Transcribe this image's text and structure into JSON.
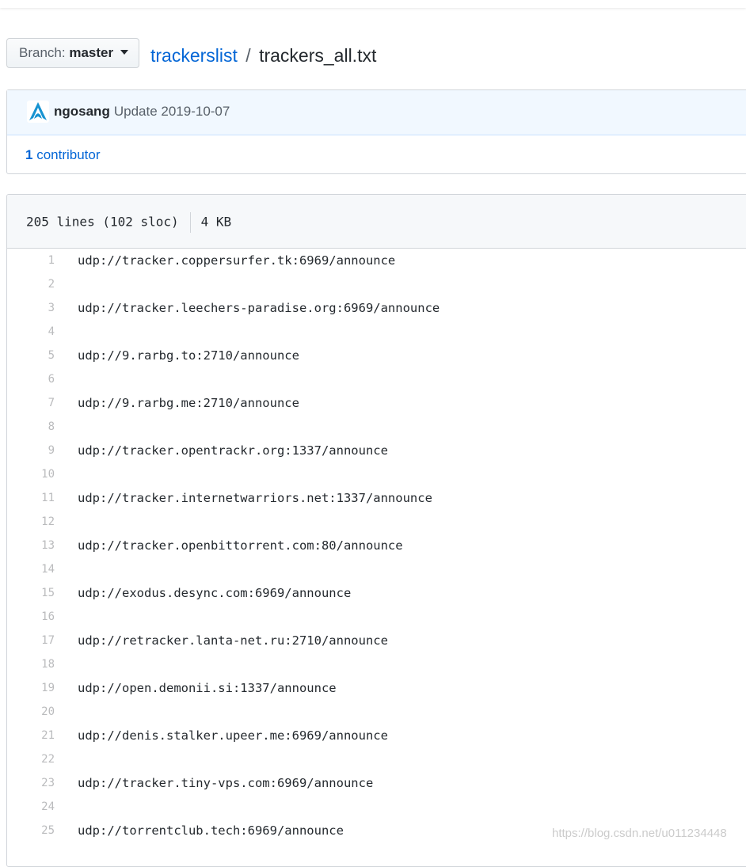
{
  "branch": {
    "prefix": "Branch:",
    "name": "master"
  },
  "breadcrumb": {
    "repo": "trackerslist",
    "separator": "/",
    "file": "trackers_all.txt"
  },
  "commit": {
    "avatar_icon": "arch-logo-icon",
    "author": "ngosang",
    "message": "Update 2019-10-07",
    "contributors_count": "1",
    "contributors_label": "contributor"
  },
  "file": {
    "lines_info": "205 lines (102 sloc)",
    "size": "4 KB"
  },
  "code_lines": [
    {
      "n": "1",
      "text": "udp://tracker.coppersurfer.tk:6969/announce"
    },
    {
      "n": "2",
      "text": ""
    },
    {
      "n": "3",
      "text": "udp://tracker.leechers-paradise.org:6969/announce"
    },
    {
      "n": "4",
      "text": ""
    },
    {
      "n": "5",
      "text": "udp://9.rarbg.to:2710/announce"
    },
    {
      "n": "6",
      "text": ""
    },
    {
      "n": "7",
      "text": "udp://9.rarbg.me:2710/announce"
    },
    {
      "n": "8",
      "text": ""
    },
    {
      "n": "9",
      "text": "udp://tracker.opentrackr.org:1337/announce"
    },
    {
      "n": "10",
      "text": ""
    },
    {
      "n": "11",
      "text": "udp://tracker.internetwarriors.net:1337/announce"
    },
    {
      "n": "12",
      "text": ""
    },
    {
      "n": "13",
      "text": "udp://tracker.openbittorrent.com:80/announce"
    },
    {
      "n": "14",
      "text": ""
    },
    {
      "n": "15",
      "text": "udp://exodus.desync.com:6969/announce"
    },
    {
      "n": "16",
      "text": ""
    },
    {
      "n": "17",
      "text": "udp://retracker.lanta-net.ru:2710/announce"
    },
    {
      "n": "18",
      "text": ""
    },
    {
      "n": "19",
      "text": "udp://open.demonii.si:1337/announce"
    },
    {
      "n": "20",
      "text": ""
    },
    {
      "n": "21",
      "text": "udp://denis.stalker.upeer.me:6969/announce"
    },
    {
      "n": "22",
      "text": ""
    },
    {
      "n": "23",
      "text": "udp://tracker.tiny-vps.com:6969/announce"
    },
    {
      "n": "24",
      "text": ""
    },
    {
      "n": "25",
      "text": "udp://torrentclub.tech:6969/announce"
    }
  ],
  "watermark": "https://blog.csdn.net/u011234448"
}
